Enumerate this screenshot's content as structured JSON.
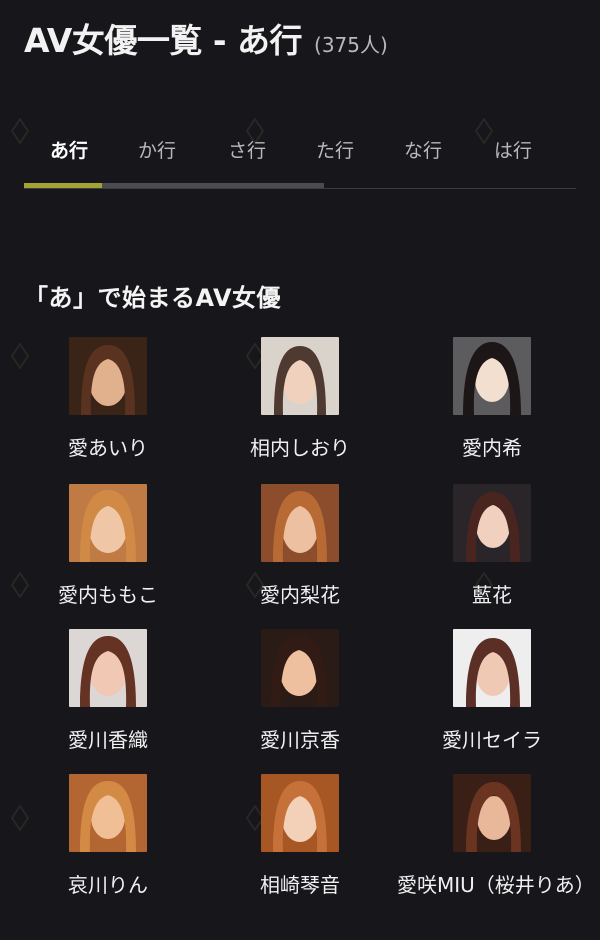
{
  "header": {
    "title": "AV女優一覧 - あ行",
    "count": "(375人)"
  },
  "tabs": [
    {
      "label": "あ行",
      "active": true
    },
    {
      "label": "か行",
      "active": false
    },
    {
      "label": "さ行",
      "active": false
    },
    {
      "label": "た行",
      "active": false
    },
    {
      "label": "な行",
      "active": false
    },
    {
      "label": "は行",
      "active": false
    }
  ],
  "colors": {
    "background": "#16161b",
    "accent": "#a3a334",
    "text": "#f2f2f2",
    "muted": "#b8b8bd"
  },
  "section": {
    "title": "「あ」で始まるAV女優"
  },
  "actresses": [
    {
      "name": "愛あいり",
      "photo": "portrait-photo"
    },
    {
      "name": "相内しおり",
      "photo": "portrait-photo"
    },
    {
      "name": "愛内希",
      "photo": "portrait-photo"
    },
    {
      "name": "愛内ももこ",
      "photo": "portrait-photo"
    },
    {
      "name": "愛内梨花",
      "photo": "portrait-photo"
    },
    {
      "name": "藍花",
      "photo": "portrait-photo"
    },
    {
      "name": "愛川香織",
      "photo": "portrait-photo"
    },
    {
      "name": "愛川京香",
      "photo": "portrait-photo"
    },
    {
      "name": "愛川セイラ",
      "photo": "portrait-photo"
    },
    {
      "name": "哀川りん",
      "photo": "portrait-photo"
    },
    {
      "name": "相崎琴音",
      "photo": "portrait-photo"
    },
    {
      "name": "愛咲MIU（桜井りあ）",
      "photo": "portrait-photo"
    }
  ]
}
